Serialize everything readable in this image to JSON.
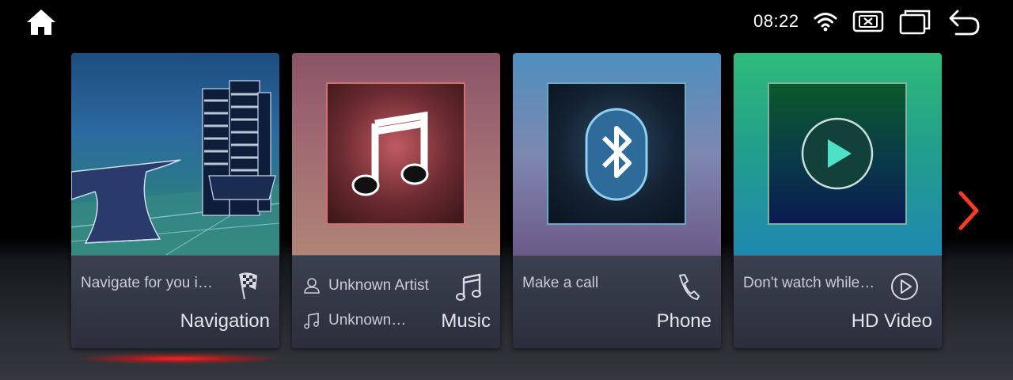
{
  "status_bar": {
    "time": "08:22",
    "icons": [
      "home-icon",
      "wifi-icon",
      "close-box-icon",
      "window-icon",
      "back-icon"
    ]
  },
  "cards": [
    {
      "id": "navigation",
      "title": "Navigation",
      "subtitle": "Navigate for you i…",
      "icon": "checkered-flag-icon",
      "selected": true
    },
    {
      "id": "music",
      "title": "Music",
      "artist": "Unknown Artist",
      "track": "Unknown…",
      "icon": "music-note-icon"
    },
    {
      "id": "phone",
      "title": "Phone",
      "subtitle": "Make a call",
      "icon": "phone-icon"
    },
    {
      "id": "video",
      "title": "HD Video",
      "subtitle": "Don't watch while…",
      "icon": "play-circle-icon"
    }
  ],
  "colors": {
    "accent": "#e8281e",
    "card_bottom": "#30343f",
    "text": "#d8dbe2"
  }
}
